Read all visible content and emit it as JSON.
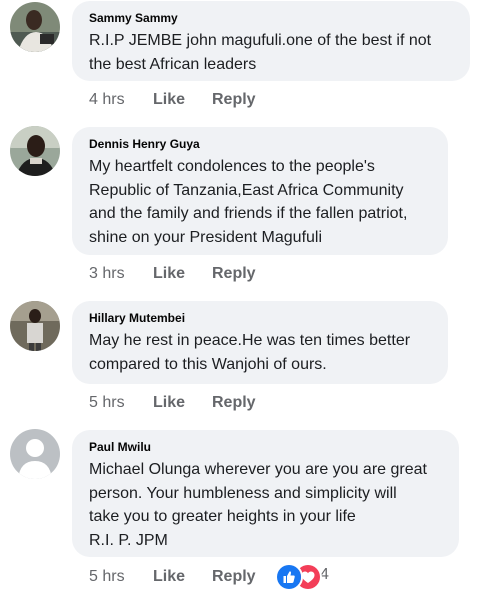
{
  "comments": [
    {
      "author": "Sammy Sammy",
      "text": "R.I.P JEMBE john magufuli.one of the best if not\nthe best African leaders",
      "time": "4 hrs",
      "like_label": "Like",
      "reply_label": "Reply"
    },
    {
      "author": "Dennis Henry Guya",
      "text": "My heartfelt condolences to the people's\nRepublic of Tanzania,East Africa Community\nand the family and friends if the fallen patriot,\nshine on your President Magufuli",
      "time": "3 hrs",
      "like_label": "Like",
      "reply_label": "Reply"
    },
    {
      "author": "Hillary Mutembei",
      "text": "May he rest in peace.He was ten times better\ncompared to this Wanjohi of ours.",
      "time": "5 hrs",
      "like_label": "Like",
      "reply_label": "Reply"
    },
    {
      "author": "Paul Mwilu",
      "text": "Michael Olunga wherever you are you are great\nperson. Your humbleness and simplicity will\ntake you to greater heights in your life\nR.I. P.  JPM",
      "time": "5 hrs",
      "like_label": "Like",
      "reply_label": "Reply",
      "reactions": {
        "icons": [
          "like-reaction-icon",
          "love-reaction-icon"
        ],
        "count": "4"
      }
    }
  ],
  "colors": {
    "bubble": "#f0f2f5",
    "meta_text": "#65676b",
    "like_blue": "#1877f2",
    "love_red": "#f33e58",
    "default_avatar": "#bcc0c4"
  }
}
